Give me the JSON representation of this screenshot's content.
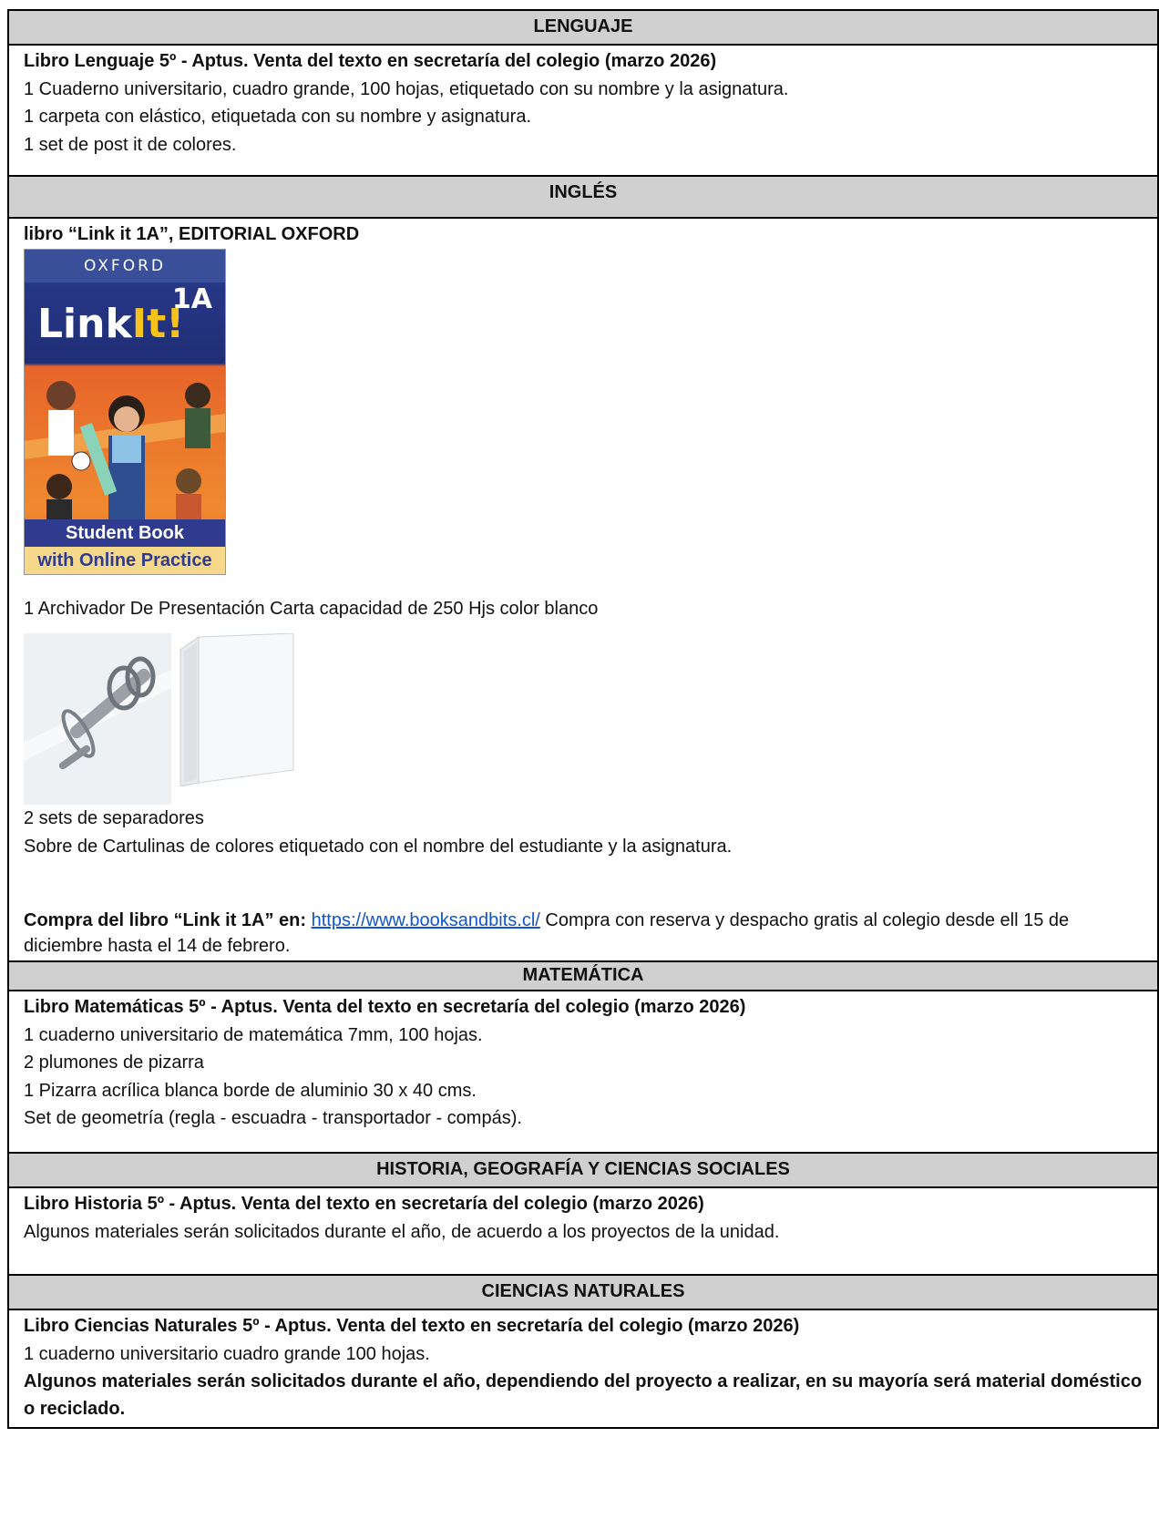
{
  "sections": {
    "lenguaje": {
      "title": "LENGUAJE",
      "items": [
        "Libro Lenguaje 5º - Aptus. Venta del texto en secretaría del colegio (marzo 2026)",
        "1 Cuaderno  universitario, cuadro grande, 100  hojas, etiquetado con su nombre y la asignatura.",
        "1 carpeta con elástico, etiquetada con su nombre y asignatura.",
        "1 set de post it de colores."
      ]
    },
    "ingles": {
      "title": "INGLÉS",
      "book_line": "libro “Link it 1A”, EDITORIAL OXFORD",
      "cover": {
        "publisher": "OXFORD",
        "logo_a": "Link",
        "logo_b": "It!",
        "level": "1A",
        "band1": "Student Book",
        "band2": "with Online Practice"
      },
      "binder_line": "1 Archivador De Presentación Carta capacidad de 250 Hjs color blanco",
      "separators": "2 sets de separadores",
      "cartulinas": "Sobre de Cartulinas de colores etiquetado con el nombre del estudiante y la asignatura.",
      "buy_bold": "Compra del libro “Link it 1A”  en:",
      "buy_link": "https://www.booksandbits.cl/",
      "buy_rest": " Compra con reserva y despacho gratis al colegio desde ell 15 de diciembre hasta el 14 de febrero."
    },
    "matematica": {
      "title": "MATEMÁTICA",
      "items": [
        "Libro Matemáticas 5º - Aptus. Venta del texto en secretaría del colegio (marzo 2026)",
        "1 cuaderno universitario de matemática 7mm, 100 hojas.",
        "2 plumones de pizarra",
        "1 Pizarra acrílica blanca borde de aluminio 30 x 40 cms.",
        "Set de geometría (regla - escuadra - transportador - compás)."
      ]
    },
    "historia": {
      "title": "HISTORIA, GEOGRAFÍA Y CIENCIAS SOCIALES",
      "items": [
        "Libro Historia 5º - Aptus. Venta del texto en secretaría del colegio (marzo 2026)",
        "Algunos materiales serán solicitados durante el año, de acuerdo a los proyectos de la unidad."
      ]
    },
    "ciencias": {
      "title": "CIENCIAS NATURALES",
      "items": [
        "Libro Ciencias Naturales  5º - Aptus. Venta del texto en secretaría del colegio (marzo 2026)",
        "1 cuaderno   universitario cuadro grande  100 hojas.",
        "Algunos materiales serán solicitados durante el año, dependiendo del proyecto a realizar, en su mayoría será material doméstico o reciclado."
      ]
    }
  }
}
